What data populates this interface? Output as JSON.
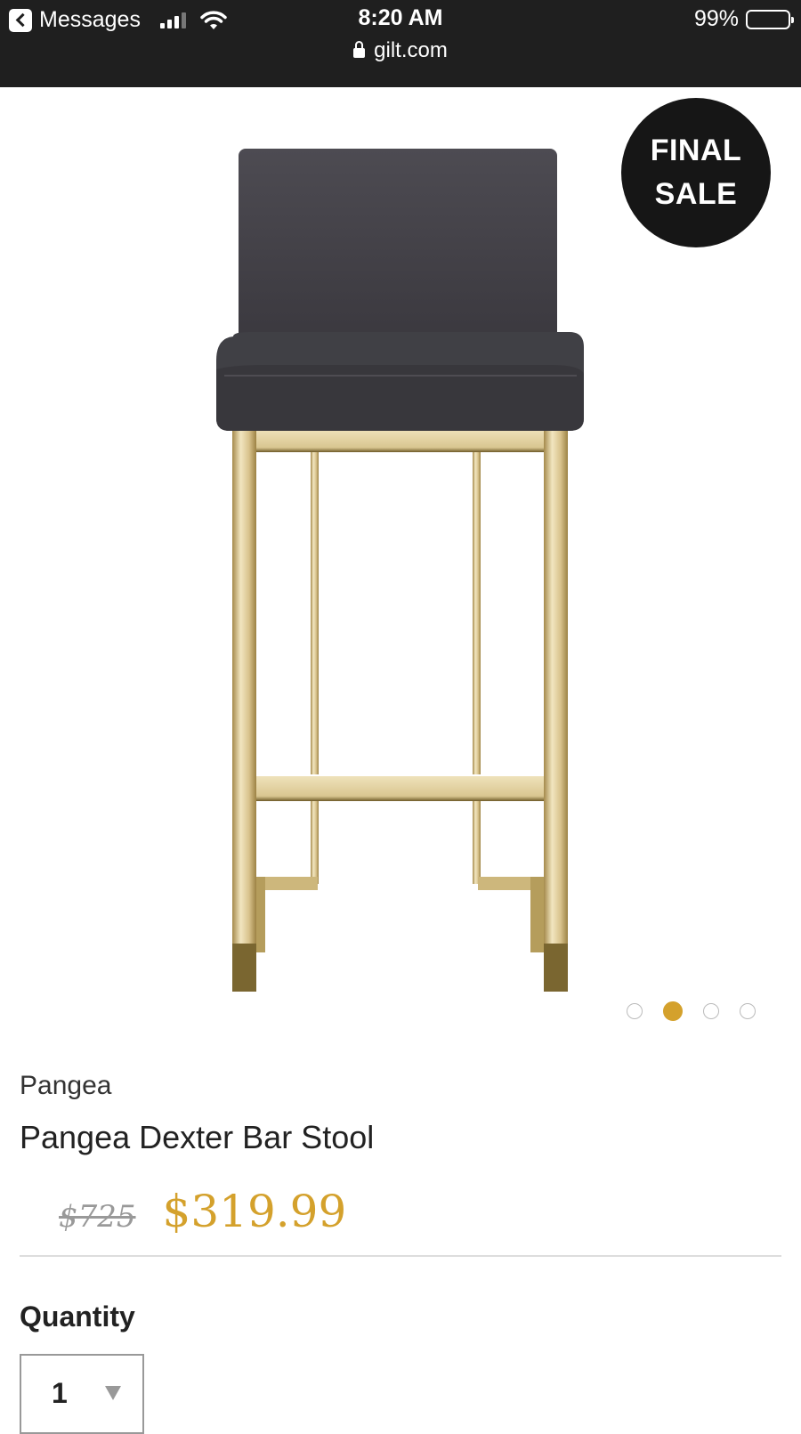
{
  "status_bar": {
    "back_app": "Messages",
    "time": "8:20 AM",
    "url": "gilt.com",
    "battery": "99%"
  },
  "product": {
    "image_alt": "Pangea Dexter Bar Stool",
    "badge_line1": "FINAL",
    "badge_line2": "SALE",
    "gallery": {
      "total": 4,
      "active_index": 2
    },
    "brand": "Pangea",
    "name": "Pangea Dexter Bar Stool",
    "original_price": "$725",
    "sale_price": "$319.99"
  },
  "quantity": {
    "label": "Quantity",
    "value": "1"
  },
  "colors": {
    "accent": "#d4a12c",
    "status_bar_bg": "#1f1f1f",
    "badge_bg": "#161616"
  }
}
